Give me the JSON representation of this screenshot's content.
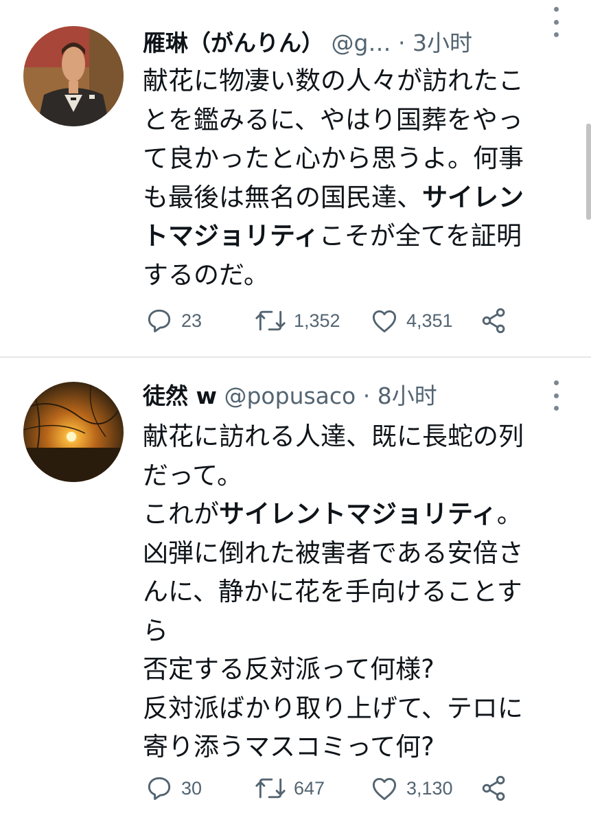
{
  "tweets": [
    {
      "name": "雁琳（がんりん）",
      "handle": "@g…",
      "separator": "·",
      "time": "3小时",
      "lines": [
        [
          {
            "t": "献花に物凄い数の人々が訪れたこ",
            "b": false
          }
        ],
        [
          {
            "t": "とを鑑みるに、やはり国葬をやっ",
            "b": false
          }
        ],
        [
          {
            "t": "て良かったと心から思うよ。何事",
            "b": false
          }
        ],
        [
          {
            "t": "も最後は無名の国民達、",
            "b": false
          },
          {
            "t": "サイレン",
            "b": true
          }
        ],
        [
          {
            "t": "トマジョリティ",
            "b": true
          },
          {
            "t": "こそが全てを証明",
            "b": false
          }
        ],
        [
          {
            "t": "するのだ。",
            "b": false
          }
        ]
      ],
      "replies": "23",
      "retweets": "1,352",
      "likes": "4,351"
    },
    {
      "name": "徒然 w",
      "handle": "@popusaco",
      "separator": "·",
      "time": "8小时",
      "lines": [
        [
          {
            "t": "献花に訪れる人達、既に長蛇の列",
            "b": false
          }
        ],
        [
          {
            "t": "だって。",
            "b": false
          }
        ],
        [
          {
            "t": "これが",
            "b": false
          },
          {
            "t": "サイレントマジョリティ",
            "b": true
          },
          {
            "t": "。",
            "b": false
          }
        ],
        [
          {
            "t": "凶弾に倒れた被害者である安倍さ",
            "b": false
          }
        ],
        [
          {
            "t": "んに、静かに花を手向けることす",
            "b": false
          }
        ],
        [
          {
            "t": "ら",
            "b": false
          }
        ],
        [
          {
            "t": "否定する反対派って何様?",
            "b": false
          }
        ],
        [
          {
            "t": "反対派ばかり取り上げて、テロに",
            "b": false
          }
        ],
        [
          {
            "t": "寄り添うマスコミって何?",
            "b": false
          }
        ]
      ],
      "replies": "30",
      "retweets": "647",
      "likes": "3,130"
    }
  ],
  "colors": {
    "text": "#0f1419",
    "secondary": "#536471",
    "divider": "#e6e6e6"
  },
  "icons": [
    "reply-icon",
    "retweet-icon",
    "like-icon",
    "share-icon",
    "more-icon"
  ]
}
